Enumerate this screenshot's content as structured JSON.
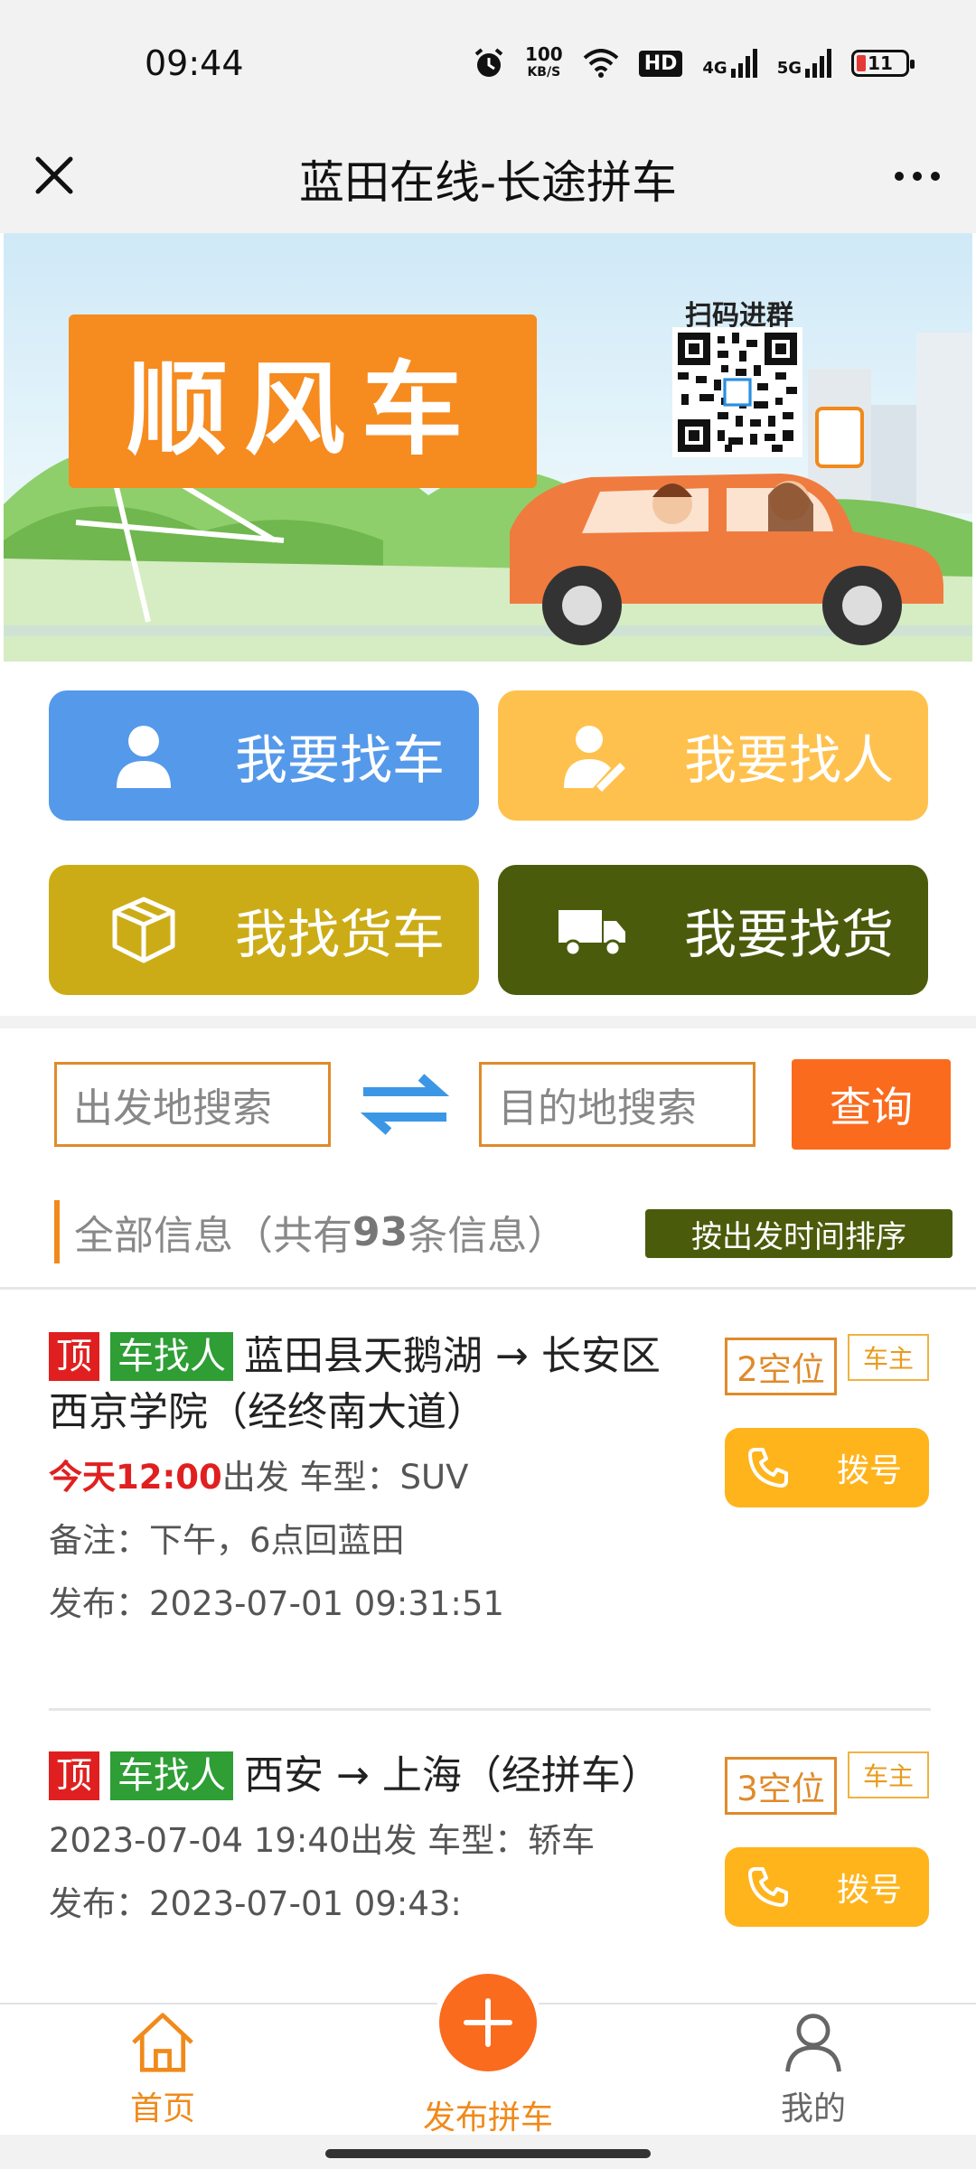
{
  "status_bar": {
    "time": "09:44",
    "net_speed_top": "100",
    "net_speed_unit": "KB/S",
    "hd_label": "HD",
    "signal_1": "4G",
    "signal_2": "5G",
    "battery": "11"
  },
  "title_bar": {
    "title": "蓝田在线-长途拼车",
    "close_icon": "close-icon",
    "more_icon": "more-icon"
  },
  "banner": {
    "title": "顺风车",
    "qr_label": "扫码进群"
  },
  "actions": {
    "find_car": "我要找车",
    "find_people": "我要找人",
    "find_truck": "我找货车",
    "find_goods": "我要找货"
  },
  "search": {
    "from_placeholder": "出发地搜索",
    "to_placeholder": "目的地搜索",
    "query_label": "查询"
  },
  "info": {
    "prefix": "全部信息（共有",
    "count": "93",
    "suffix": "条信息）",
    "sort_label": "按出发时间排序"
  },
  "listings": [
    {
      "tag_top": "顶",
      "tag_type": "车找人",
      "route": "蓝田县天鹅湖 → 长安区西京学院（经终南大道）",
      "time_highlight": "今天12:00",
      "depart_text": "出发 车型：SUV",
      "note": "备注：下午，6点回蓝田",
      "published": "发布：2023-07-01 09:31:51",
      "seats": "2空位",
      "owner": "车主",
      "dial_label": "拨号"
    },
    {
      "tag_top": "顶",
      "tag_type": "车找人",
      "route": "西安 → 上海（经拼车）",
      "depart_text": "2023-07-04 19:40出发 车型：轿车",
      "published": "发布：2023-07-01 09:43:",
      "seats": "3空位",
      "owner": "车主",
      "dial_label": "拨号"
    }
  ],
  "bottom_nav": {
    "home": "首页",
    "publish": "发布拼车",
    "mine": "我的"
  },
  "colors": {
    "orange": "#fa6b1e",
    "blue": "#5599ea",
    "yellow": "#ffc14d",
    "olive": "#ccac16",
    "dark_green": "#4a5c0c",
    "red": "#e02020",
    "green": "#2e9e35"
  }
}
